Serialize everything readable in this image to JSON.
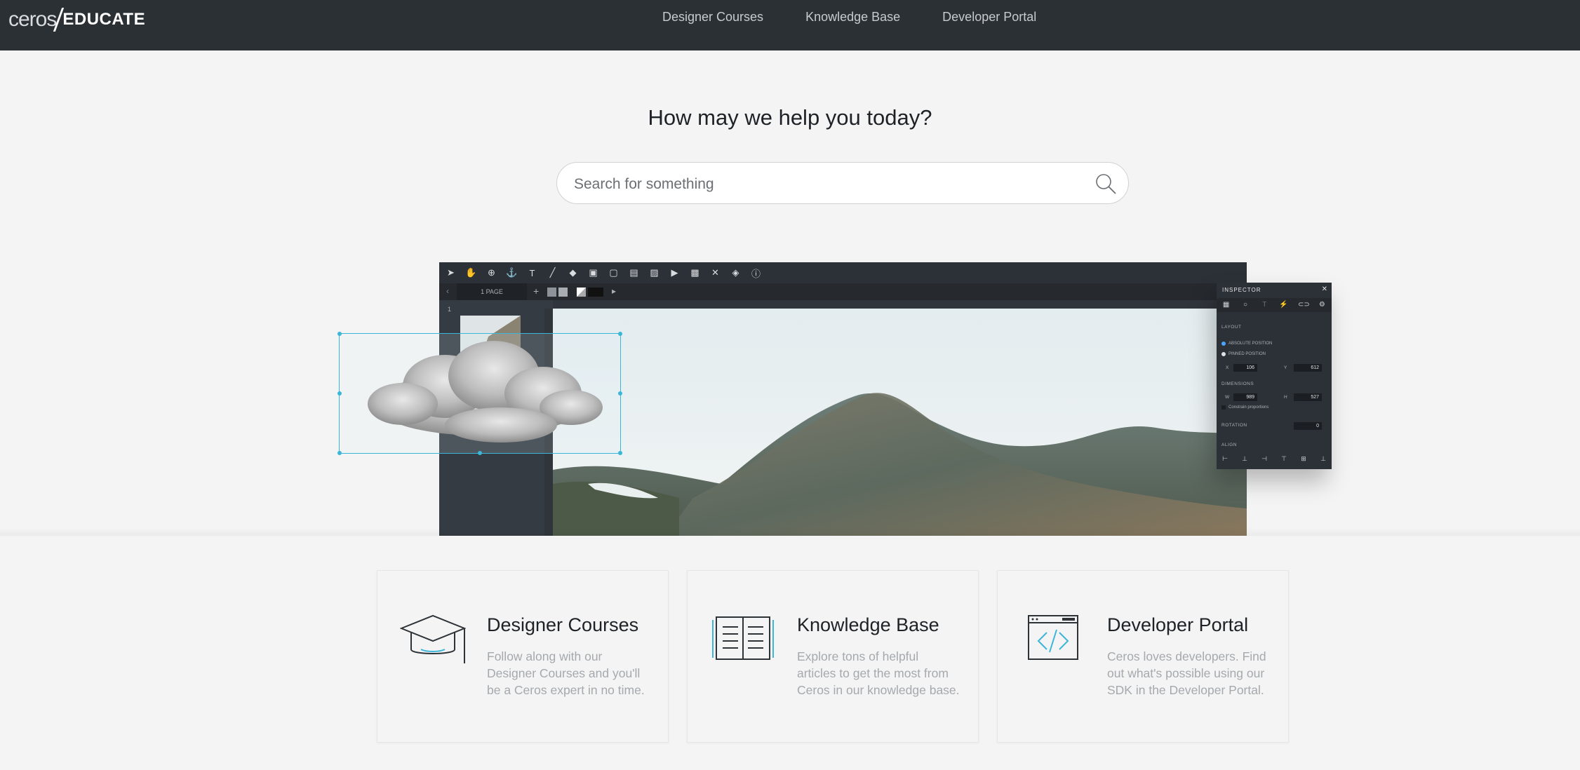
{
  "nav": {
    "logo_ceros": "ceros",
    "logo_educate": "EDUCATE",
    "links": [
      "Designer Courses",
      "Knowledge Base",
      "Developer Portal"
    ]
  },
  "hero": {
    "title": "How may we help you today?",
    "search_placeholder": "Search for something"
  },
  "editor": {
    "page_count": "1 PAGE",
    "page_number": "1",
    "inspector": {
      "title": "INSPECTOR",
      "section_layout": "LAYOUT",
      "absolute_position": "ABSOLUTE POSITION",
      "pinned_position": "PINNED POSITION",
      "x_label": "X",
      "x_value": "106",
      "y_label": "Y",
      "y_value": "612",
      "section_dimensions": "DIMENSIONS",
      "w_label": "W",
      "w_value": "989",
      "h_label": "H",
      "h_value": "527",
      "constrain": "Constrain proportions",
      "section_rotation": "ROTATION",
      "rotation_value": "0",
      "section_align": "ALIGN"
    }
  },
  "cards": [
    {
      "title": "Designer Courses",
      "desc": "Follow along with our Designer Courses and you'll be a Ceros expert in no time."
    },
    {
      "title": "Knowledge Base",
      "desc": "Explore tons of helpful articles to get the most from Ceros in our knowledge base."
    },
    {
      "title": "Developer Portal",
      "desc": "Ceros loves developers. Find out what's possible using our SDK in the Developer Portal."
    }
  ],
  "colors": {
    "nav_bg": "#2b3035",
    "page_bg": "#f4f4f4",
    "accent": "#3cb6d8",
    "editor_bg": "#2c3137"
  }
}
